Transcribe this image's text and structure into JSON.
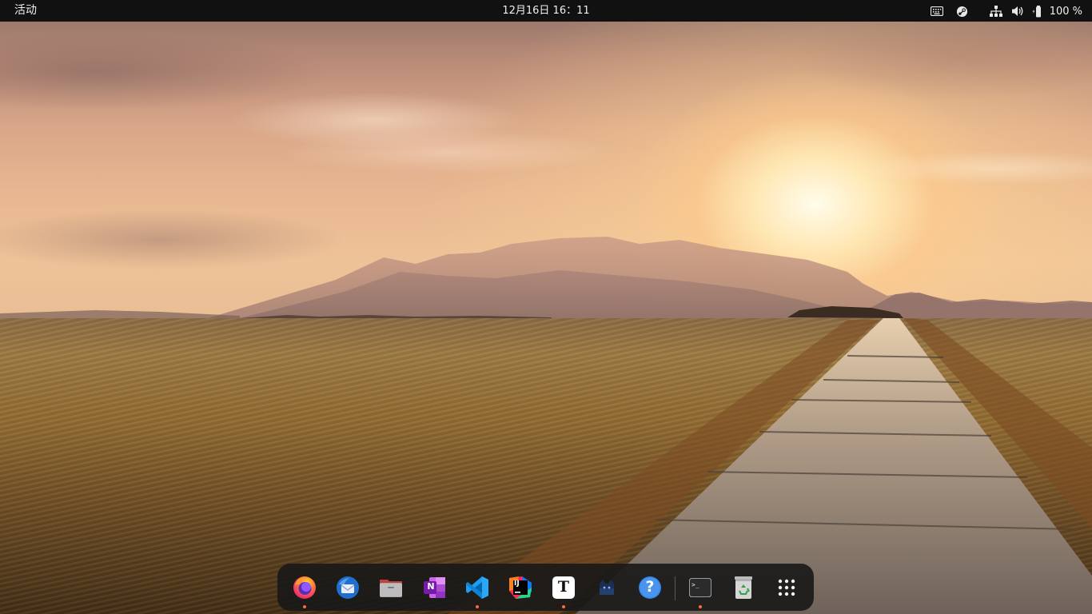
{
  "topbar": {
    "activities_label": "活动",
    "clock": "12月16日  16：11",
    "tray": {
      "keyboard_icon": "keyboard-icon",
      "steam_icon": "steam-icon",
      "network_icon": "network-wired-icon",
      "volume_icon": "volume-icon",
      "battery_icon": "battery-icon",
      "battery_text": "100 %"
    }
  },
  "dock": {
    "items": [
      {
        "name": "firefox",
        "icon": "firefox-icon",
        "running": true
      },
      {
        "name": "thunderbird",
        "icon": "thunderbird-icon",
        "running": false
      },
      {
        "name": "files",
        "icon": "folder-icon",
        "running": false
      },
      {
        "name": "onenote",
        "icon": "onenote-icon",
        "running": false
      },
      {
        "name": "vscode",
        "icon": "vscode-icon",
        "running": true
      },
      {
        "name": "intellij",
        "icon": "intellij-icon",
        "running": false
      },
      {
        "name": "typora",
        "icon": "typora-icon",
        "running": true
      },
      {
        "name": "cat-app",
        "icon": "cat-icon",
        "running": false
      },
      {
        "name": "help",
        "icon": "help-icon",
        "running": false
      },
      {
        "name": "terminal",
        "icon": "terminal-icon",
        "running": true
      },
      {
        "name": "trash",
        "icon": "trash-icon",
        "running": false
      },
      {
        "name": "show-apps",
        "icon": "app-grid-icon",
        "running": false
      }
    ],
    "labels": {
      "onenote": "N",
      "intellij": "IJ",
      "typora": "T",
      "help": "?",
      "terminal": ">_"
    }
  },
  "colors": {
    "topbar_bg": "#111111",
    "dock_bg": "#181818",
    "running_indicator": "#ff6a3d"
  }
}
